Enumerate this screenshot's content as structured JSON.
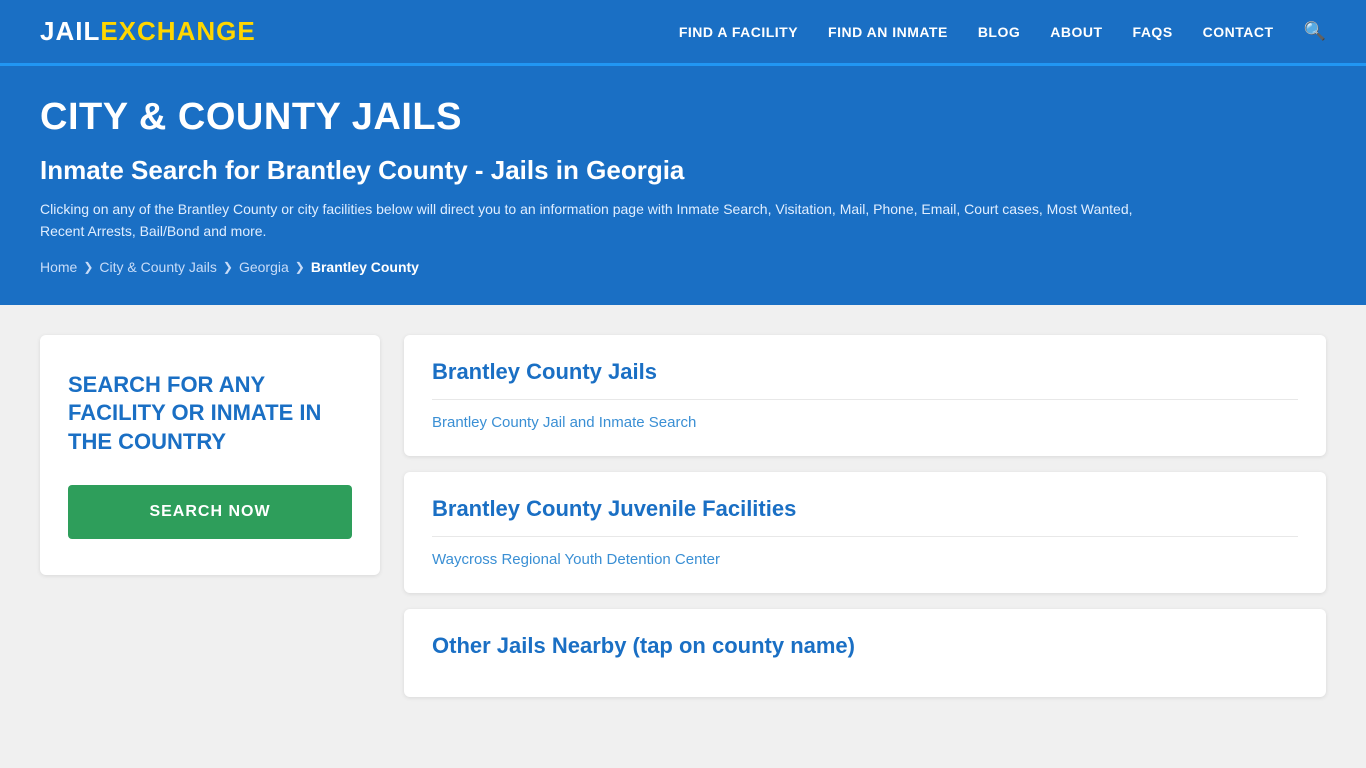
{
  "logo": {
    "part1": "JAIL",
    "part2": "EXCHANGE"
  },
  "nav": {
    "items": [
      {
        "label": "FIND A FACILITY",
        "id": "find-facility"
      },
      {
        "label": "FIND AN INMATE",
        "id": "find-inmate"
      },
      {
        "label": "BLOG",
        "id": "blog"
      },
      {
        "label": "ABOUT",
        "id": "about"
      },
      {
        "label": "FAQs",
        "id": "faqs"
      },
      {
        "label": "CONTACT",
        "id": "contact"
      }
    ]
  },
  "hero": {
    "title": "CITY & COUNTY JAILS",
    "subtitle": "Inmate Search for Brantley County - Jails in Georgia",
    "description": "Clicking on any of the Brantley County or city facilities below will direct you to an information page with Inmate Search, Visitation, Mail, Phone, Email, Court cases, Most Wanted, Recent Arrests, Bail/Bond and more.",
    "breadcrumb": {
      "items": [
        {
          "label": "Home",
          "id": "home"
        },
        {
          "label": "City & County Jails",
          "id": "city-county-jails"
        },
        {
          "label": "Georgia",
          "id": "georgia"
        },
        {
          "label": "Brantley County",
          "id": "brantley-county",
          "current": true
        }
      ]
    }
  },
  "search_card": {
    "title": "SEARCH FOR ANY FACILITY OR INMATE IN THE COUNTRY",
    "button_label": "SEARCH NOW"
  },
  "facility_cards": [
    {
      "title": "Brantley County Jails",
      "link_label": "Brantley County Jail and Inmate Search"
    },
    {
      "title": "Brantley County Juvenile Facilities",
      "link_label": "Waycross Regional Youth Detention Center"
    },
    {
      "title": "Other Jails Nearby (tap on county name)",
      "link_label": ""
    }
  ]
}
